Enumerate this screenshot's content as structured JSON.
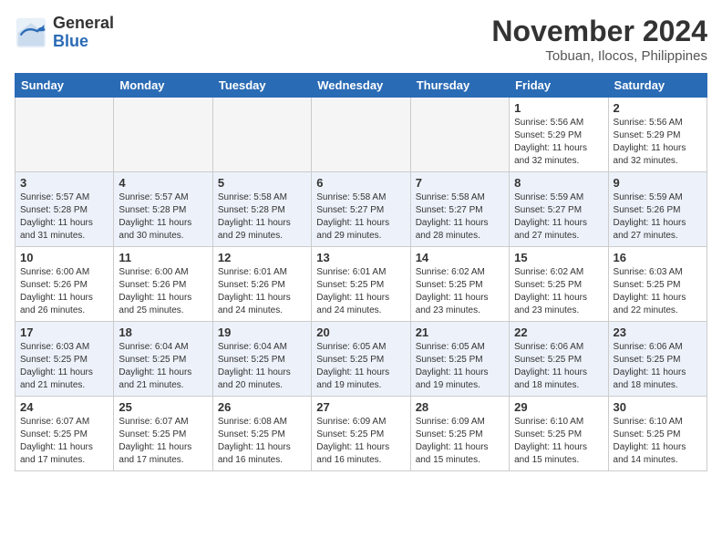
{
  "header": {
    "logo_general": "General",
    "logo_blue": "Blue",
    "month_year": "November 2024",
    "location": "Tobuan, Ilocos, Philippines"
  },
  "days_of_week": [
    "Sunday",
    "Monday",
    "Tuesday",
    "Wednesday",
    "Thursday",
    "Friday",
    "Saturday"
  ],
  "weeks": [
    [
      {
        "day": "",
        "empty": true
      },
      {
        "day": "",
        "empty": true
      },
      {
        "day": "",
        "empty": true
      },
      {
        "day": "",
        "empty": true
      },
      {
        "day": "",
        "empty": true
      },
      {
        "day": "1",
        "sunrise": "5:56 AM",
        "sunset": "5:29 PM",
        "daylight": "11 hours and 32 minutes."
      },
      {
        "day": "2",
        "sunrise": "5:56 AM",
        "sunset": "5:29 PM",
        "daylight": "11 hours and 32 minutes."
      }
    ],
    [
      {
        "day": "3",
        "sunrise": "5:57 AM",
        "sunset": "5:28 PM",
        "daylight": "11 hours and 31 minutes."
      },
      {
        "day": "4",
        "sunrise": "5:57 AM",
        "sunset": "5:28 PM",
        "daylight": "11 hours and 30 minutes."
      },
      {
        "day": "5",
        "sunrise": "5:58 AM",
        "sunset": "5:28 PM",
        "daylight": "11 hours and 29 minutes."
      },
      {
        "day": "6",
        "sunrise": "5:58 AM",
        "sunset": "5:27 PM",
        "daylight": "11 hours and 29 minutes."
      },
      {
        "day": "7",
        "sunrise": "5:58 AM",
        "sunset": "5:27 PM",
        "daylight": "11 hours and 28 minutes."
      },
      {
        "day": "8",
        "sunrise": "5:59 AM",
        "sunset": "5:27 PM",
        "daylight": "11 hours and 27 minutes."
      },
      {
        "day": "9",
        "sunrise": "5:59 AM",
        "sunset": "5:26 PM",
        "daylight": "11 hours and 27 minutes."
      }
    ],
    [
      {
        "day": "10",
        "sunrise": "6:00 AM",
        "sunset": "5:26 PM",
        "daylight": "11 hours and 26 minutes."
      },
      {
        "day": "11",
        "sunrise": "6:00 AM",
        "sunset": "5:26 PM",
        "daylight": "11 hours and 25 minutes."
      },
      {
        "day": "12",
        "sunrise": "6:01 AM",
        "sunset": "5:26 PM",
        "daylight": "11 hours and 24 minutes."
      },
      {
        "day": "13",
        "sunrise": "6:01 AM",
        "sunset": "5:25 PM",
        "daylight": "11 hours and 24 minutes."
      },
      {
        "day": "14",
        "sunrise": "6:02 AM",
        "sunset": "5:25 PM",
        "daylight": "11 hours and 23 minutes."
      },
      {
        "day": "15",
        "sunrise": "6:02 AM",
        "sunset": "5:25 PM",
        "daylight": "11 hours and 23 minutes."
      },
      {
        "day": "16",
        "sunrise": "6:03 AM",
        "sunset": "5:25 PM",
        "daylight": "11 hours and 22 minutes."
      }
    ],
    [
      {
        "day": "17",
        "sunrise": "6:03 AM",
        "sunset": "5:25 PM",
        "daylight": "11 hours and 21 minutes."
      },
      {
        "day": "18",
        "sunrise": "6:04 AM",
        "sunset": "5:25 PM",
        "daylight": "11 hours and 21 minutes."
      },
      {
        "day": "19",
        "sunrise": "6:04 AM",
        "sunset": "5:25 PM",
        "daylight": "11 hours and 20 minutes."
      },
      {
        "day": "20",
        "sunrise": "6:05 AM",
        "sunset": "5:25 PM",
        "daylight": "11 hours and 19 minutes."
      },
      {
        "day": "21",
        "sunrise": "6:05 AM",
        "sunset": "5:25 PM",
        "daylight": "11 hours and 19 minutes."
      },
      {
        "day": "22",
        "sunrise": "6:06 AM",
        "sunset": "5:25 PM",
        "daylight": "11 hours and 18 minutes."
      },
      {
        "day": "23",
        "sunrise": "6:06 AM",
        "sunset": "5:25 PM",
        "daylight": "11 hours and 18 minutes."
      }
    ],
    [
      {
        "day": "24",
        "sunrise": "6:07 AM",
        "sunset": "5:25 PM",
        "daylight": "11 hours and 17 minutes."
      },
      {
        "day": "25",
        "sunrise": "6:07 AM",
        "sunset": "5:25 PM",
        "daylight": "11 hours and 17 minutes."
      },
      {
        "day": "26",
        "sunrise": "6:08 AM",
        "sunset": "5:25 PM",
        "daylight": "11 hours and 16 minutes."
      },
      {
        "day": "27",
        "sunrise": "6:09 AM",
        "sunset": "5:25 PM",
        "daylight": "11 hours and 16 minutes."
      },
      {
        "day": "28",
        "sunrise": "6:09 AM",
        "sunset": "5:25 PM",
        "daylight": "11 hours and 15 minutes."
      },
      {
        "day": "29",
        "sunrise": "6:10 AM",
        "sunset": "5:25 PM",
        "daylight": "11 hours and 15 minutes."
      },
      {
        "day": "30",
        "sunrise": "6:10 AM",
        "sunset": "5:25 PM",
        "daylight": "11 hours and 14 minutes."
      }
    ]
  ]
}
